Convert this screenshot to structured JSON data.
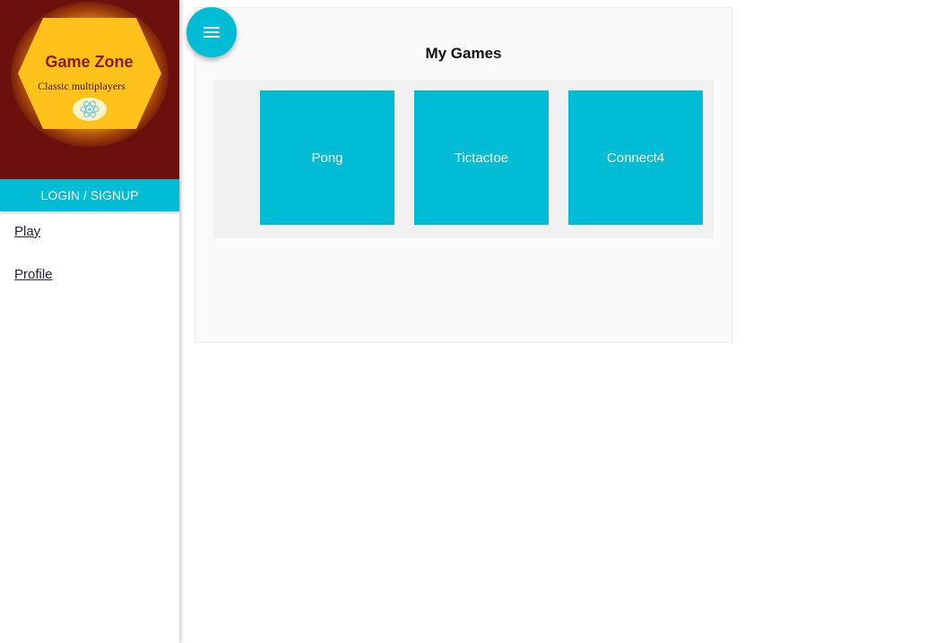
{
  "colors": {
    "accent": "#00bcd4",
    "brand_bg": "#6b100d",
    "brand_hexagon": "#ffc21a",
    "brand_title": "#8a1a12"
  },
  "brand": {
    "title": "Game Zone",
    "subtitle": "Classic multiplayers",
    "logo_icon": "react-atom-icon"
  },
  "sidebar": {
    "login_label": "LOGIN / SIGNUP",
    "links": [
      {
        "label": "Play"
      },
      {
        "label": "Profile"
      }
    ]
  },
  "toolbar": {
    "menu_icon": "menu-icon"
  },
  "main": {
    "title": "My Games",
    "games": [
      {
        "label": "Pong"
      },
      {
        "label": "Tictactoe"
      },
      {
        "label": "Connect4"
      }
    ]
  }
}
